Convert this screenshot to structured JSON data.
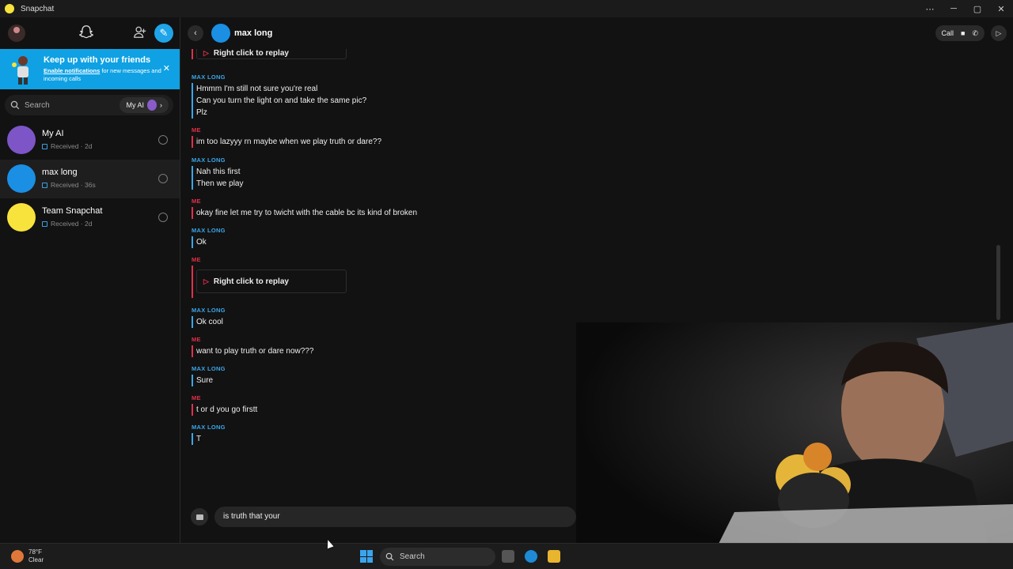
{
  "titlebar": {
    "app_title": "Snapchat",
    "controls": [
      "⋯",
      "─",
      "▢",
      "✕"
    ]
  },
  "sidebar": {
    "banner": {
      "title": "Keep up with your friends",
      "link": "Enable notifications",
      "text": " for new messages and incoming calls"
    },
    "search": {
      "placeholder": "Search",
      "my_ai": "My AI"
    },
    "chats": [
      {
        "name": "My AI",
        "status": "Received · 2d"
      },
      {
        "name": "max long",
        "status": "Received · 36s"
      },
      {
        "name": "Team Snapchat",
        "status": "Received · 2d"
      }
    ]
  },
  "chat": {
    "header_name": "max long",
    "call_label": "Call",
    "messages": [
      {
        "sender": "ME",
        "type": "snap",
        "lines": [
          "Right click to replay"
        ]
      },
      {
        "sender": "MAX LONG",
        "lines": [
          "Hmmm I'm still not sure you're real",
          "Can you turn the light on and take the same pic?",
          "Plz"
        ]
      },
      {
        "sender": "ME",
        "lines": [
          "im too lazyyy rn maybe when we play truth or dare??"
        ]
      },
      {
        "sender": "MAX LONG",
        "lines": [
          "Nah this first",
          "Then we play"
        ]
      },
      {
        "sender": "ME",
        "lines": [
          "okay fine let me try to twicht with the cable bc its kind of broken"
        ]
      },
      {
        "sender": "MAX LONG",
        "lines": [
          "Ok"
        ]
      },
      {
        "sender": "ME",
        "type": "snap",
        "lines": [
          "Right click to replay"
        ]
      },
      {
        "sender": "MAX LONG",
        "lines": [
          "Ok cool"
        ]
      },
      {
        "sender": "ME",
        "lines": [
          "want to play truth or dare now???"
        ]
      },
      {
        "sender": "MAX LONG",
        "lines": [
          "Sure"
        ]
      },
      {
        "sender": "ME",
        "lines": [
          "t or d you go firstt"
        ]
      },
      {
        "sender": "MAX LONG",
        "lines": [
          "T"
        ]
      }
    ],
    "composer_text": "is truth that your"
  },
  "taskbar": {
    "temperature": "78°F",
    "condition": "Clear",
    "search": "Search"
  },
  "colors": {
    "accent_blue": "#1fa4e8",
    "them": "#3aa6e8",
    "me": "#e0304a",
    "banner": "#0fa1e3"
  }
}
